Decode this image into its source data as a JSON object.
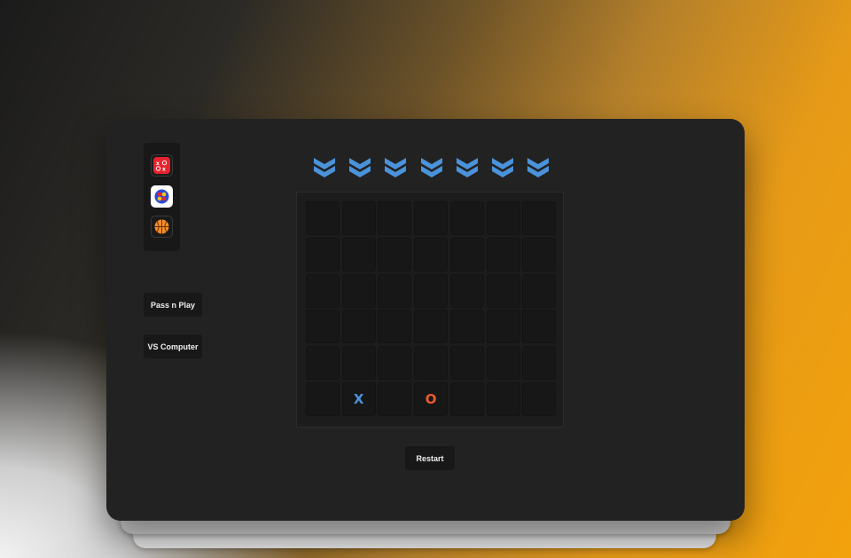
{
  "apps": [
    {
      "name": "tic-tac-toe",
      "icon": "tic-tac-toe-icon",
      "color": "#e8222e"
    },
    {
      "name": "connect-four",
      "icon": "connect-four-icon",
      "color": "#2a4bd7"
    },
    {
      "name": "basketball",
      "icon": "basketball-icon",
      "color": "#f28c28"
    }
  ],
  "modes": {
    "pass_label": "Pass n Play",
    "vs_label": "VS Computer"
  },
  "board": {
    "columns": 7,
    "rows": 6,
    "drop_arrow_color": "#4a93db",
    "cells": [
      [
        "",
        "",
        "",
        "",
        "",
        "",
        ""
      ],
      [
        "",
        "",
        "",
        "",
        "",
        "",
        ""
      ],
      [
        "",
        "",
        "",
        "",
        "",
        "",
        ""
      ],
      [
        "",
        "",
        "",
        "",
        "",
        "",
        ""
      ],
      [
        "",
        "",
        "",
        "",
        "",
        "",
        ""
      ],
      [
        "",
        "X",
        "",
        "O",
        "",
        "",
        ""
      ]
    ]
  },
  "colors": {
    "x": "#4a93db",
    "o": "#ea5b2a"
  },
  "restart_label": "Restart"
}
